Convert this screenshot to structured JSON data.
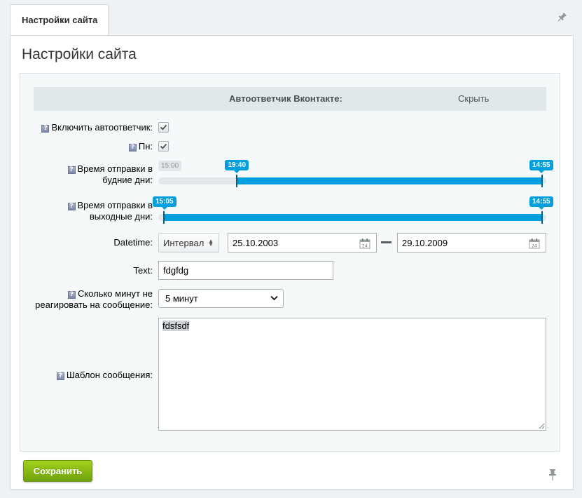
{
  "tab": {
    "label": "Настройки сайта"
  },
  "page": {
    "title": "Настройки сайта"
  },
  "section": {
    "title": "Автоответчик Вконтакте:",
    "hide_label": "Скрыть"
  },
  "fields": {
    "autoresponder": {
      "label": "Включить автоответчик:",
      "checked": true
    },
    "monday": {
      "label": "Пн:",
      "checked": true
    },
    "weekday_time": {
      "label_line1": "Время отправки в",
      "label_line2": "будние дни:",
      "ghost_value": "15:00",
      "from": "19:40",
      "to": "14:55",
      "from_position_percent": 20.3,
      "to_position_percent": 98.9
    },
    "weekend_time": {
      "label_line1": "Время отправки в",
      "label_line2": "выходные дни:",
      "from": "15:05",
      "to": "14:55",
      "from_position_percent": 1.5,
      "to_position_percent": 98.9
    },
    "datetime": {
      "label": "Datetime:",
      "mode": "Интервал",
      "date_from": "25.10.2003",
      "date_to": "29.10.2009"
    },
    "text": {
      "label": "Text:",
      "value": "fdgfdg"
    },
    "ignore_minutes": {
      "label_line1": "Сколько минут не",
      "label_line2": "реагировать на сообщение:",
      "value": "5 минут"
    },
    "template": {
      "label": "Шаблон сообщения:",
      "value": "fdsfsdf"
    }
  },
  "help_icon_glyph": "?",
  "calendar_day": "24",
  "footer": {
    "save_label": "Сохранить"
  },
  "colors": {
    "accent_slider": "#019fdd",
    "save_button": "#8cbb14",
    "section_header": "#e0e8ea"
  }
}
